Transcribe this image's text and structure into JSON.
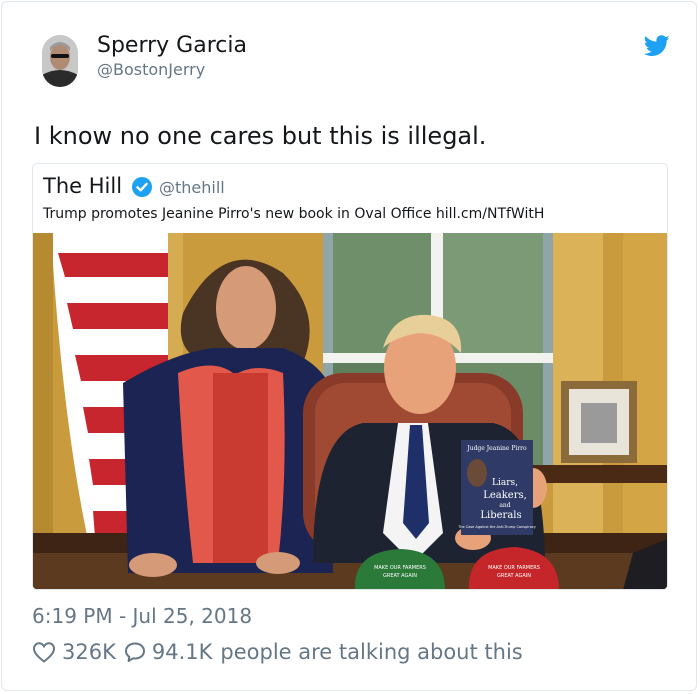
{
  "tweet": {
    "author": {
      "display_name": "Sperry Garcia",
      "handle": "@BostonJerry",
      "avatar": "user-avatar"
    },
    "logo_icon": "twitter-bird-icon",
    "text": "I know no one cares but this is illegal.",
    "timestamp": "6:19 PM - Jul 25, 2018",
    "stats": {
      "likes": "326K",
      "like_icon": "heart-icon",
      "replies": "94.1K",
      "reply_icon": "speech-bubble-icon",
      "talking_label": "people are talking about this"
    }
  },
  "quoted_tweet": {
    "display_name": "The Hill",
    "verified_icon": "verified-badge-icon",
    "handle": "@thehill",
    "text": "Trump promotes Jeanine Pirro's new book in Oval Office hill.cm/NTfWitH",
    "photo": {
      "book": {
        "author": "Judge Jeanine Pirro",
        "title_lines": [
          "Liars,",
          "Leakers,",
          "and",
          "Liberals"
        ],
        "subtitle": "The Case Against the Anti-Trump Conspiracy"
      },
      "hat_text_lines": [
        "MAKE OUR FARMERS",
        "GREAT AGAIN"
      ]
    }
  },
  "colors": {
    "text_primary": "#14171a",
    "text_secondary": "#657786",
    "twitter_blue": "#1da1f2",
    "border": "#e1e8ed"
  }
}
